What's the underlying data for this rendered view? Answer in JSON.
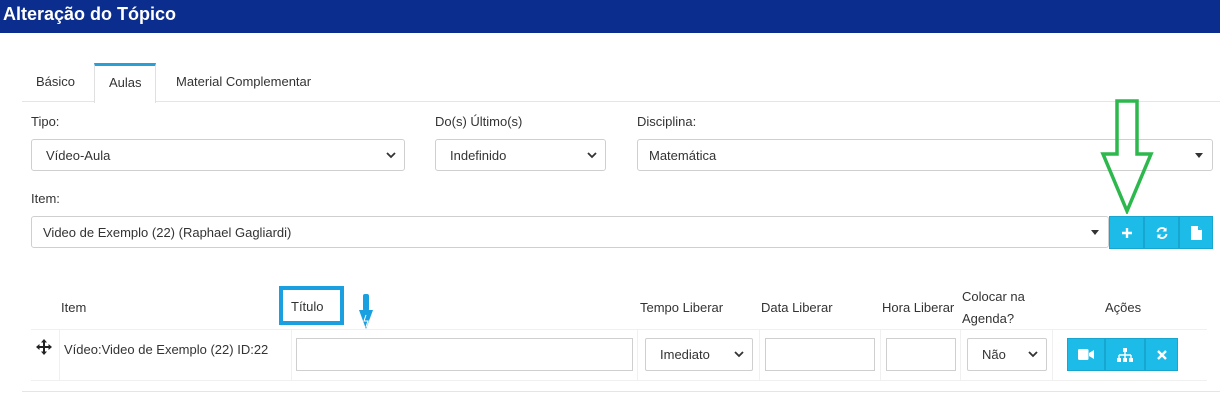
{
  "header": {
    "title": "Alteração do Tópico"
  },
  "tabs": [
    {
      "label": "Básico"
    },
    {
      "label": "Aulas"
    },
    {
      "label": "Material Complementar"
    }
  ],
  "form": {
    "tipo": {
      "label": "Tipo:",
      "value": "Vídeo-Aula"
    },
    "ultimos": {
      "label": "Do(s) Último(s)",
      "value": "Indefinido"
    },
    "disciplina": {
      "label": "Disciplina:",
      "value": "Matemática"
    },
    "item": {
      "label": "Item:",
      "value": "Video de Exemplo (22) (Raphael Gagliardi)"
    }
  },
  "table": {
    "headers": {
      "item": "Item",
      "titulo": "Título",
      "tempo_liberar": "Tempo Liberar",
      "data_liberar": "Data Liberar",
      "hora_liberar": "Hora Liberar",
      "colocar_agenda_line1": "Colocar na",
      "colocar_agenda_line2": "Agenda?",
      "acoes": "Ações"
    },
    "rows": [
      {
        "item": "Vídeo:Video de Exemplo (22) ID:22",
        "titulo": "",
        "tempo_liberar": "Imediato",
        "data_liberar": "",
        "hora_liberar": "",
        "colocar_agenda": "Não"
      }
    ]
  },
  "colors": {
    "header_bg": "#0b2d8e",
    "button_bg": "#1dbbe8",
    "annotation_green": "#2db84d",
    "annotation_blue": "#1a9fe0"
  },
  "icons": [
    "plus-icon",
    "refresh-icon",
    "file-icon",
    "move-icon",
    "video-icon",
    "sitemap-icon",
    "times-icon",
    "chevron-down-icon"
  ]
}
